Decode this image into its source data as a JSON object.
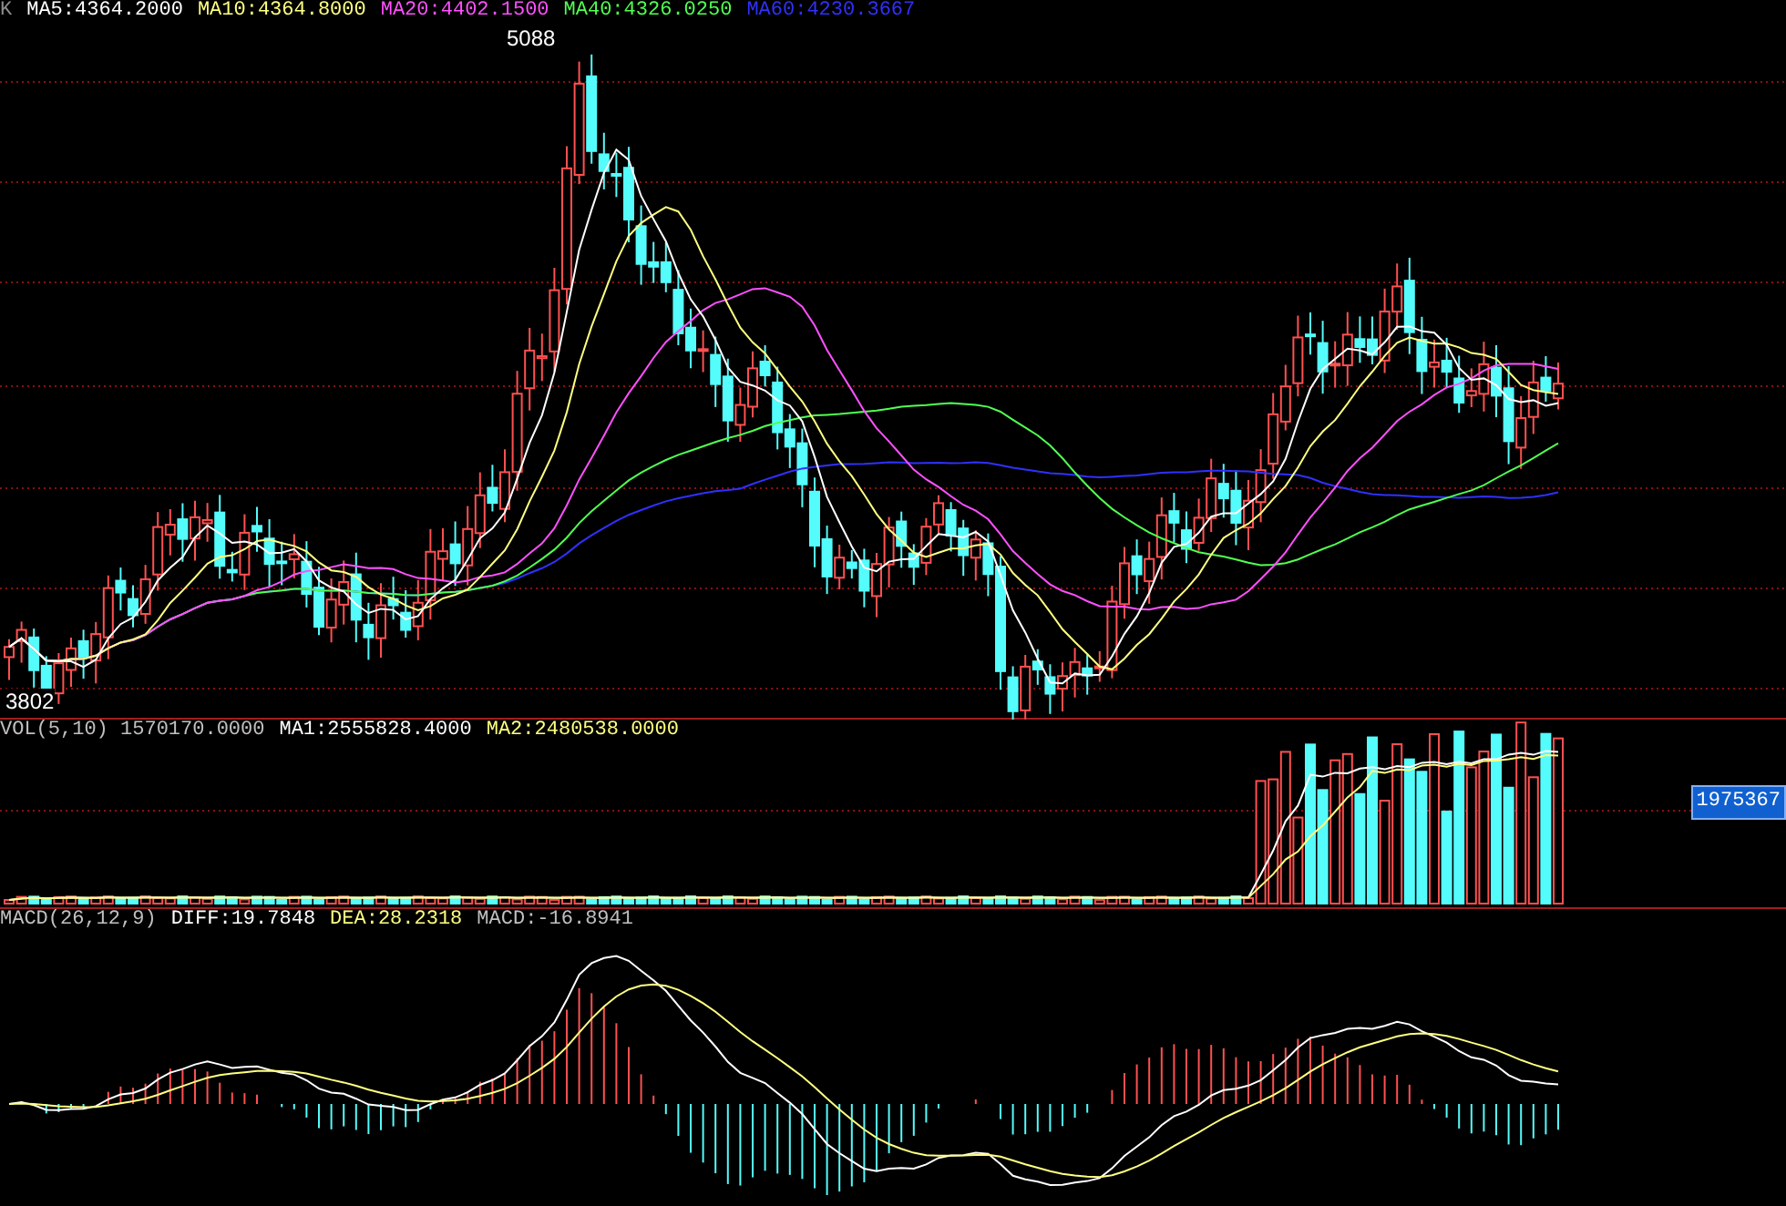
{
  "price_panel": {
    "legend": [
      {
        "label": "K",
        "color": "#8c8c8c"
      },
      {
        "label": "MA5:4364.2000",
        "color": "#ffffff"
      },
      {
        "label": "MA10:4364.8000",
        "color": "#ffff80"
      },
      {
        "label": "MA20:4402.1500",
        "color": "#ff50ff"
      },
      {
        "label": "MA40:4326.0250",
        "color": "#50ff50"
      },
      {
        "label": "MA60:4230.3667",
        "color": "#3030ff"
      }
    ],
    "high_label": "5088",
    "low_label": "3802"
  },
  "volume_panel": {
    "legend": [
      {
        "label": "VOL(5,10) 1570170.0000",
        "color": "#c0c0c0"
      },
      {
        "label": "MA1:2555828.4000",
        "color": "#ffffff"
      },
      {
        "label": "MA2:2480538.0000",
        "color": "#ffff80"
      }
    ],
    "value_tag": "1975367"
  },
  "macd_panel": {
    "legend": [
      {
        "label": "MACD(26,12,9)",
        "color": "#c0c0c0"
      },
      {
        "label": "DIFF:19.7848",
        "color": "#ffffff"
      },
      {
        "label": "DEA:28.2318",
        "color": "#ffff80"
      },
      {
        "label": "MACD:-16.8941",
        "color": "#c0c0c0"
      }
    ]
  }
}
